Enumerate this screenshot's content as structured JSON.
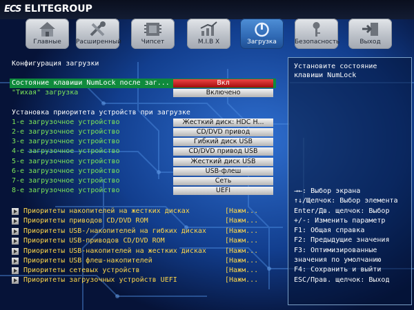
{
  "brand": {
    "name": "ELITEGROUP",
    "mark": "ECS"
  },
  "tabs": [
    {
      "label": "Главные",
      "icon": "home-icon"
    },
    {
      "label": "Расширенный",
      "icon": "tools-icon"
    },
    {
      "label": "Чипсет",
      "icon": "chip-icon"
    },
    {
      "label": "M.I.B X",
      "icon": "chart-icon"
    },
    {
      "label": "Загрузка",
      "icon": "power-icon",
      "active": true
    },
    {
      "label": "Безопасность",
      "icon": "key-icon"
    },
    {
      "label": "Выход",
      "icon": "exit-icon"
    }
  ],
  "main": {
    "section_title": "Конфигурация загрузки",
    "numlock": {
      "label": "Состояние клавиши NumLock после заг...",
      "value": "Вкл"
    },
    "quiet": {
      "label": "\"Тихая\" загрузка",
      "value": "Включено"
    },
    "priority_title": "Установка приоритета устройств при загрузке",
    "boot_devices": [
      {
        "label": "1-е загрузочное устройство",
        "value": "Жесткий диск: HDC H..."
      },
      {
        "label": "2-е загрузочное устройство",
        "value": "CD/DVD привод"
      },
      {
        "label": "3-е загрузочное устройство",
        "value": "Гибкий диск USB"
      },
      {
        "label": "4-е загрузочное устройство",
        "value": "CD/DVD привод USB"
      },
      {
        "label": "5-е загрузочное устройство",
        "value": "Жесткий диск USB"
      },
      {
        "label": "6-е загрузочное устройство",
        "value": "USB-флеш"
      },
      {
        "label": "7-е загрузочное устройство",
        "value": "Сеть"
      },
      {
        "label": "8-е загрузочное устройство",
        "value": "UEFI"
      }
    ],
    "submenus": [
      {
        "label": "Приоритеты накопителей на жестких дисках",
        "action": "[Нажм..."
      },
      {
        "label": "Приоритеты приводов CD/DVD ROM",
        "action": "[Нажм..."
      },
      {
        "label": "Приоритеты USB-/накопителей на гибких дисках",
        "action": "[Нажм..."
      },
      {
        "label": "Приоритеты USB-приводов CD/DVD ROM",
        "action": "[Нажм..."
      },
      {
        "label": "Приоритеты USB-накопителей на жестких дисках",
        "action": "[Нажм..."
      },
      {
        "label": "Приоритеты USB флеш-накопителей",
        "action": "[Нажм..."
      },
      {
        "label": "Приоритеты сетевых устройств",
        "action": "[Нажм..."
      },
      {
        "label": "Приоритеты загрузочных устройств UEFI",
        "action": "[Нажм..."
      }
    ]
  },
  "help_panel": {
    "text": "Установите состояние клавиши NumLock",
    "keys": [
      "→←: Выбор экрана",
      "↑↓/Щелчок: Выбор элемента",
      "Enter/Дв. щелчок: Выбор",
      "+/-: Изменить параметр",
      "F1: Общая справка",
      "F2: Предыдущие значения",
      "F3: Оптимизированные",
      "значения по умолчанию",
      "F4: Сохранить и выйти",
      "ESC/Прав. щелчок: Выход"
    ]
  },
  "colors": {
    "background": "#06173a",
    "selected_row": "#0f8a3c",
    "option_label": "#7ee858",
    "submenu_label": "#ffd84a",
    "active_tab": "#2f69b4"
  }
}
